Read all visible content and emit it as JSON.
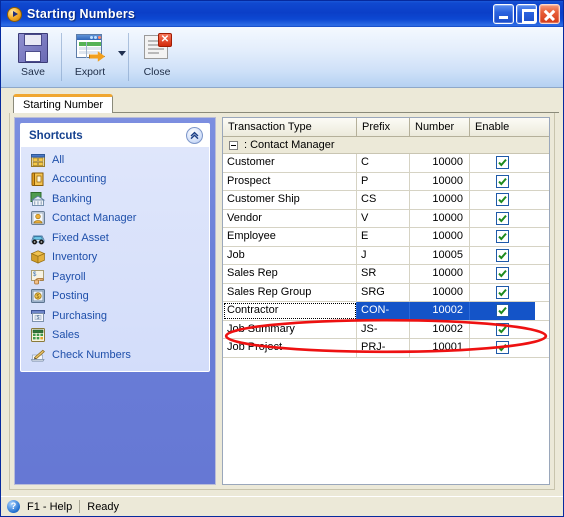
{
  "window": {
    "title": "Starting Numbers",
    "title_icon": "orange-play-icon",
    "buttons": {
      "minimize": "minimize-button",
      "maximize": "maximize-button",
      "close": "close-button"
    }
  },
  "toolbar": {
    "items": [
      {
        "label": "Save",
        "icon": "floppy-disk-icon",
        "has_dropdown": false
      },
      {
        "label": "Export",
        "icon": "export-spreadsheet-icon",
        "has_dropdown": true
      },
      {
        "label": "Close",
        "icon": "close-document-icon",
        "has_dropdown": false
      }
    ]
  },
  "tabs": [
    {
      "label": "Starting Number",
      "active": true
    }
  ],
  "sidebar": {
    "header": "Shortcuts",
    "collapse_icon": "chevron-up-icon",
    "items": [
      {
        "label": "All",
        "icon": "all-grid-icon"
      },
      {
        "label": "Accounting",
        "icon": "accounting-book-icon"
      },
      {
        "label": "Banking",
        "icon": "banking-bank-icon"
      },
      {
        "label": "Contact Manager",
        "icon": "contact-person-icon"
      },
      {
        "label": "Fixed Asset",
        "icon": "fixed-asset-car-icon"
      },
      {
        "label": "Inventory",
        "icon": "inventory-box-icon"
      },
      {
        "label": "Payroll",
        "icon": "payroll-hand-icon"
      },
      {
        "label": "Posting",
        "icon": "posting-coin-icon"
      },
      {
        "label": "Purchasing",
        "icon": "purchasing-money-icon"
      },
      {
        "label": "Sales",
        "icon": "sales-calculator-icon"
      },
      {
        "label": "Check Numbers",
        "icon": "check-numbers-pen-icon"
      }
    ]
  },
  "grid": {
    "columns": [
      "Transaction Type",
      "Prefix",
      "Number",
      "Enable"
    ],
    "group": {
      "expander": "collapse-expander",
      "label": ": Contact Manager",
      "expanded": true
    },
    "rows": [
      {
        "type": "Customer",
        "prefix": "C",
        "number": "10000",
        "enabled": true,
        "selected": false
      },
      {
        "type": "Prospect",
        "prefix": "P",
        "number": "10000",
        "enabled": true,
        "selected": false
      },
      {
        "type": "Customer Ship",
        "prefix": "CS",
        "number": "10000",
        "enabled": true,
        "selected": false
      },
      {
        "type": "Vendor",
        "prefix": "V",
        "number": "10000",
        "enabled": true,
        "selected": false
      },
      {
        "type": "Employee",
        "prefix": "E",
        "number": "10000",
        "enabled": true,
        "selected": false
      },
      {
        "type": "Job",
        "prefix": "J",
        "number": "10005",
        "enabled": true,
        "selected": false
      },
      {
        "type": "Sales Rep",
        "prefix": "SR",
        "number": "10000",
        "enabled": true,
        "selected": false
      },
      {
        "type": "Sales Rep Group",
        "prefix": "SRG",
        "number": "10000",
        "enabled": true,
        "selected": false
      },
      {
        "type": "Contractor",
        "prefix": "CON-",
        "number": "10002",
        "enabled": true,
        "selected": true
      },
      {
        "type": "Job Summary",
        "prefix": "JS-",
        "number": "10002",
        "enabled": true,
        "selected": false
      },
      {
        "type": "Job Project",
        "prefix": "PRJ-",
        "number": "10001",
        "enabled": true,
        "selected": false
      }
    ]
  },
  "annotation": {
    "shape": "ellipse",
    "color": "#ee1111",
    "target_row": "Contractor"
  },
  "statusbar": {
    "help": "F1 - Help",
    "status": "Ready",
    "help_icon": "question-mark-icon"
  },
  "colors": {
    "title_blue": "#0b3fc8",
    "selection_blue": "#1454c8",
    "client_beige": "#ece9d8",
    "sidebar_blue": "#6a7fd8",
    "tab_orange": "#f0a732",
    "link_blue": "#1e4faa",
    "annotation_red": "#ee1111"
  }
}
